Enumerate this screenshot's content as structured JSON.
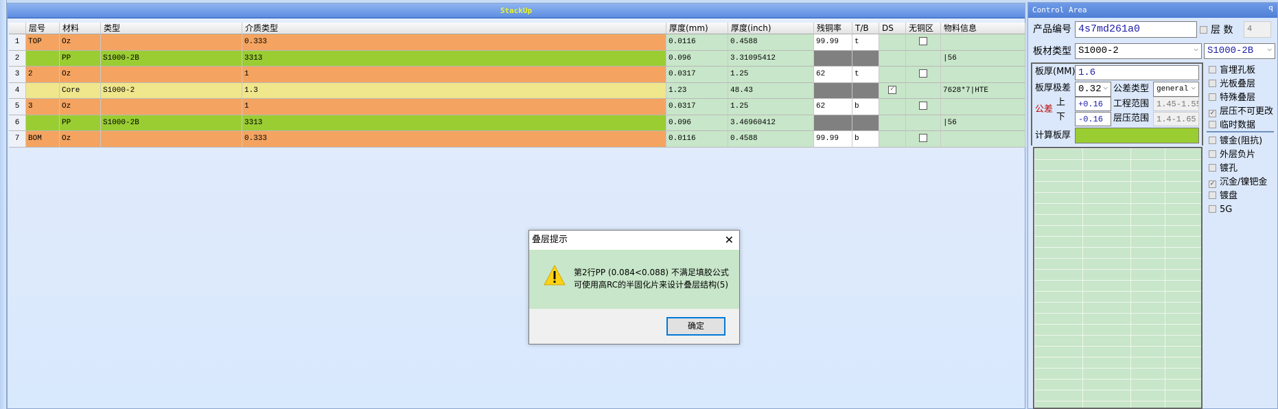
{
  "stackup": {
    "title": "StackUp",
    "columns": [
      "层号",
      "材料",
      "类型",
      "介质类型",
      "厚度(mm)",
      "厚度(inch)",
      "残铜率",
      "T/B",
      "DS",
      "无铜区",
      "物料信息"
    ],
    "rows": [
      {
        "n": "1",
        "layer": "TOP",
        "material": "Oz",
        "type": "",
        "dielectric": "0.333",
        "mm": "0.0116",
        "inch": "0.4588",
        "residual": "99.99",
        "tb": "t",
        "ds": null,
        "nocopper": false,
        "info": "",
        "kind": "copper"
      },
      {
        "n": "2",
        "layer": "",
        "material": "PP",
        "type": "S1000-2B",
        "dielectric": "3313",
        "mm": "0.096",
        "inch": "3.31095412",
        "residual": "",
        "tb": "",
        "ds": null,
        "nocopper": null,
        "info": "|56",
        "kind": "pp"
      },
      {
        "n": "3",
        "layer": "2",
        "material": "Oz",
        "type": "",
        "dielectric": "1",
        "mm": "0.0317",
        "inch": "1.25",
        "residual": "62",
        "tb": "t",
        "ds": null,
        "nocopper": false,
        "info": "",
        "kind": "copper"
      },
      {
        "n": "4",
        "layer": "",
        "material": "Core",
        "type": "S1000-2",
        "dielectric": "1.3",
        "mm": "1.23",
        "inch": "48.43",
        "residual": "",
        "tb": "",
        "ds": true,
        "nocopper": null,
        "info": "7628*7|HTE",
        "kind": "core"
      },
      {
        "n": "5",
        "layer": "3",
        "material": "Oz",
        "type": "",
        "dielectric": "1",
        "mm": "0.0317",
        "inch": "1.25",
        "residual": "62",
        "tb": "b",
        "ds": null,
        "nocopper": false,
        "info": "",
        "kind": "copper"
      },
      {
        "n": "6",
        "layer": "",
        "material": "PP",
        "type": "S1000-2B",
        "dielectric": "3313",
        "mm": "0.096",
        "inch": "3.46960412",
        "residual": "",
        "tb": "",
        "ds": null,
        "nocopper": null,
        "info": "|56",
        "kind": "pp"
      },
      {
        "n": "7",
        "layer": "BOM",
        "material": "Oz",
        "type": "",
        "dielectric": "0.333",
        "mm": "0.0116",
        "inch": "0.4588",
        "residual": "99.99",
        "tb": "b",
        "ds": null,
        "nocopper": false,
        "info": "",
        "kind": "copper"
      }
    ]
  },
  "colors": {
    "copper": "#f4a460",
    "pp": "#9acd32",
    "core": "#f0e68c",
    "cell": "#c8e6c9",
    "disabled": "#808080"
  },
  "dialog": {
    "title": "叠层提示",
    "line1": "第2行PP (0.084<0.088) 不满足填胶公式",
    "line2": "可使用高RC的半固化片来设计叠层结构(5)",
    "ok": "确定",
    "icon": "warning-icon"
  },
  "control": {
    "title": "Control Area",
    "pin": "ꟼ",
    "product_label": "产品编号",
    "product_value": "4s7md261a0",
    "layers_label": "层 数",
    "layers_value": "4",
    "material_label": "板材类型",
    "material_value": "S1000-2",
    "material2_value": "S1000-2B",
    "thickness_label": "板厚(MM)",
    "thickness_value": "1.6",
    "tolerance_label": "板厚极差",
    "tolerance_value": "0.32",
    "tol_type_label": "公差类型",
    "tol_type_value": "general",
    "tol_label": "公差",
    "upper_label": "上",
    "lower_label": "下",
    "upper_value": "+0.16",
    "lower_value": "-0.16",
    "eng_range_label": "工程范围",
    "eng_range_value": "1.45-1.55",
    "press_range_label": "层压范围",
    "press_range_value": "1.4-1.65",
    "calc_label": "计算板厚",
    "options_a": [
      {
        "label": "盲埋孔板",
        "checked": false
      },
      {
        "label": "光板叠层",
        "checked": false
      },
      {
        "label": "特殊叠层",
        "checked": false
      },
      {
        "label": "层压不可更改",
        "checked": true
      },
      {
        "label": "临时数据",
        "checked": false
      }
    ],
    "options_b": [
      {
        "label": "镀金(阻抗)",
        "checked": false
      },
      {
        "label": "外层负片",
        "checked": false
      },
      {
        "label": "镀孔",
        "checked": false
      },
      {
        "label": "沉金/镍钯金",
        "checked": true
      },
      {
        "label": "镀盘",
        "checked": false
      },
      {
        "label": "5G",
        "checked": false
      }
    ]
  }
}
